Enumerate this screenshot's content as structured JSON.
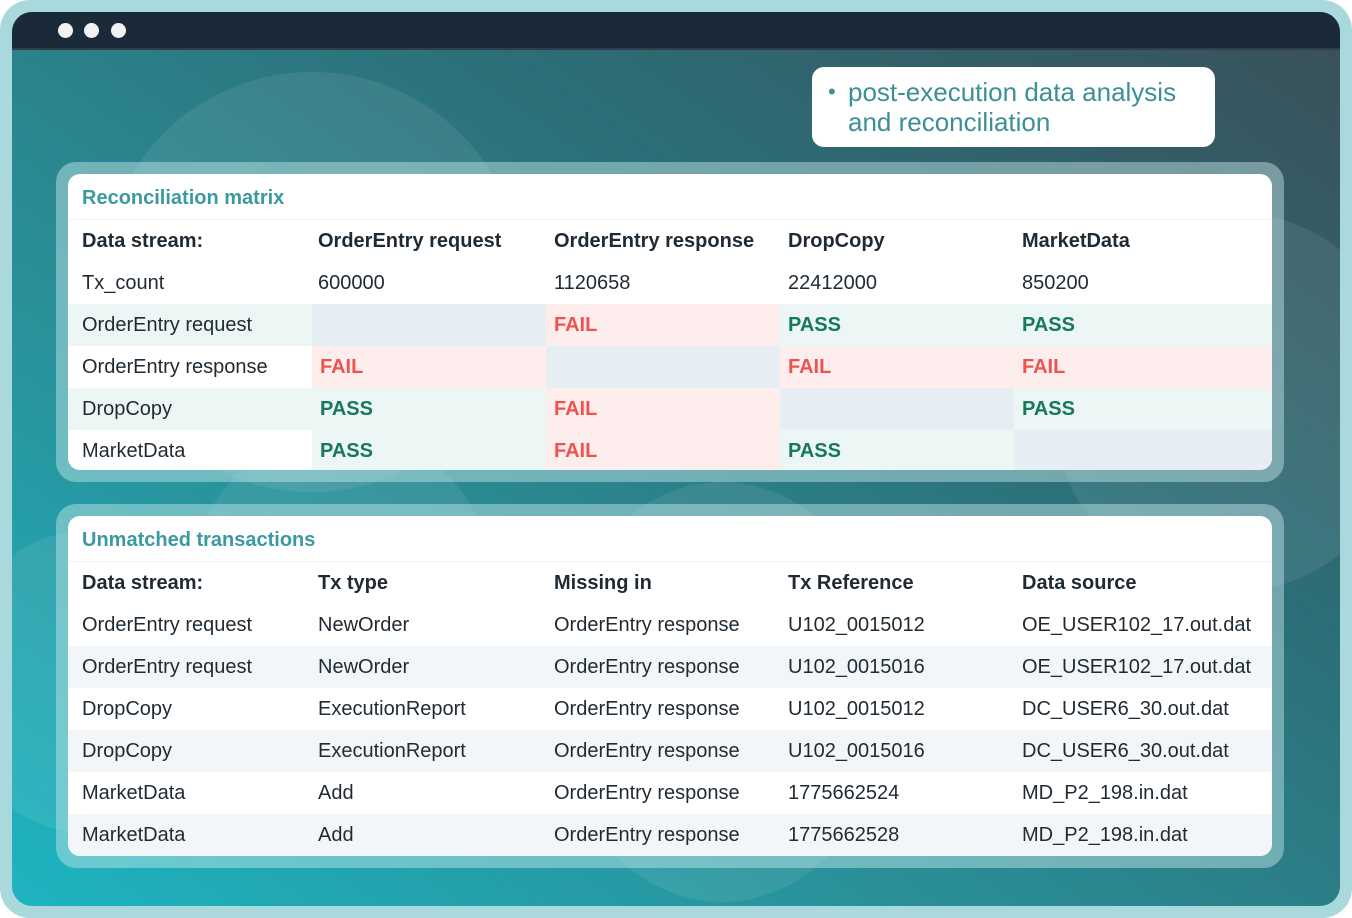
{
  "window": {
    "dot_color": "#f2f2f2"
  },
  "callout": {
    "bullet": "•",
    "lines": [
      "post-execution data analysis",
      "and reconciliation"
    ]
  },
  "matrix": {
    "title": "Reconciliation matrix",
    "headers": [
      "Data stream:",
      "OrderEntry request",
      "OrderEntry response",
      "DropCopy",
      "MarketData"
    ],
    "tx_count": {
      "label": "Tx_count",
      "values": [
        "600000",
        "1120658",
        "22412000",
        "850200"
      ]
    },
    "rows": [
      {
        "label": "OrderEntry request",
        "cells": [
          "",
          "FAIL",
          "PASS",
          "PASS"
        ]
      },
      {
        "label": "OrderEntry response",
        "cells": [
          "FAIL",
          "",
          "FAIL",
          "FAIL"
        ]
      },
      {
        "label": "DropCopy",
        "cells": [
          "PASS",
          "FAIL",
          "",
          "PASS"
        ]
      },
      {
        "label": "MarketData",
        "cells": [
          "PASS",
          "FAIL",
          "PASS",
          ""
        ]
      }
    ],
    "colors": {
      "fail_text": "#ef5350",
      "pass_text": "#16785c",
      "fail_bg": "#fdeeed",
      "pass_bg": "#ecf6f5",
      "blank_bg": "#e6edf3"
    }
  },
  "unmatched": {
    "title": "Unmatched transactions",
    "headers": [
      "Data stream:",
      "Tx type",
      "Missing in",
      "Tx Reference",
      "Data source"
    ],
    "rows": [
      [
        "OrderEntry request",
        "NewOrder",
        "OrderEntry response",
        "U102_0015012",
        "OE_USER102_17.out.dat"
      ],
      [
        "OrderEntry request",
        "NewOrder",
        "OrderEntry response",
        "U102_0015016",
        "OE_USER102_17.out.dat"
      ],
      [
        "DropCopy",
        "ExecutionReport",
        "OrderEntry response",
        "U102_0015012",
        "DC_USER6_30.out.dat"
      ],
      [
        "DropCopy",
        "ExecutionReport",
        "OrderEntry response",
        "U102_0015016",
        "DC_USER6_30.out.dat"
      ],
      [
        "MarketData",
        "Add",
        "OrderEntry response",
        "1775662524",
        "MD_P2_198.in.dat"
      ],
      [
        "MarketData",
        "Add",
        "OrderEntry response",
        "1775662528",
        "MD_P2_198.in.dat"
      ]
    ]
  },
  "theme": {
    "accent": "#3a9aa0",
    "titlebar": "#1a2a38"
  }
}
